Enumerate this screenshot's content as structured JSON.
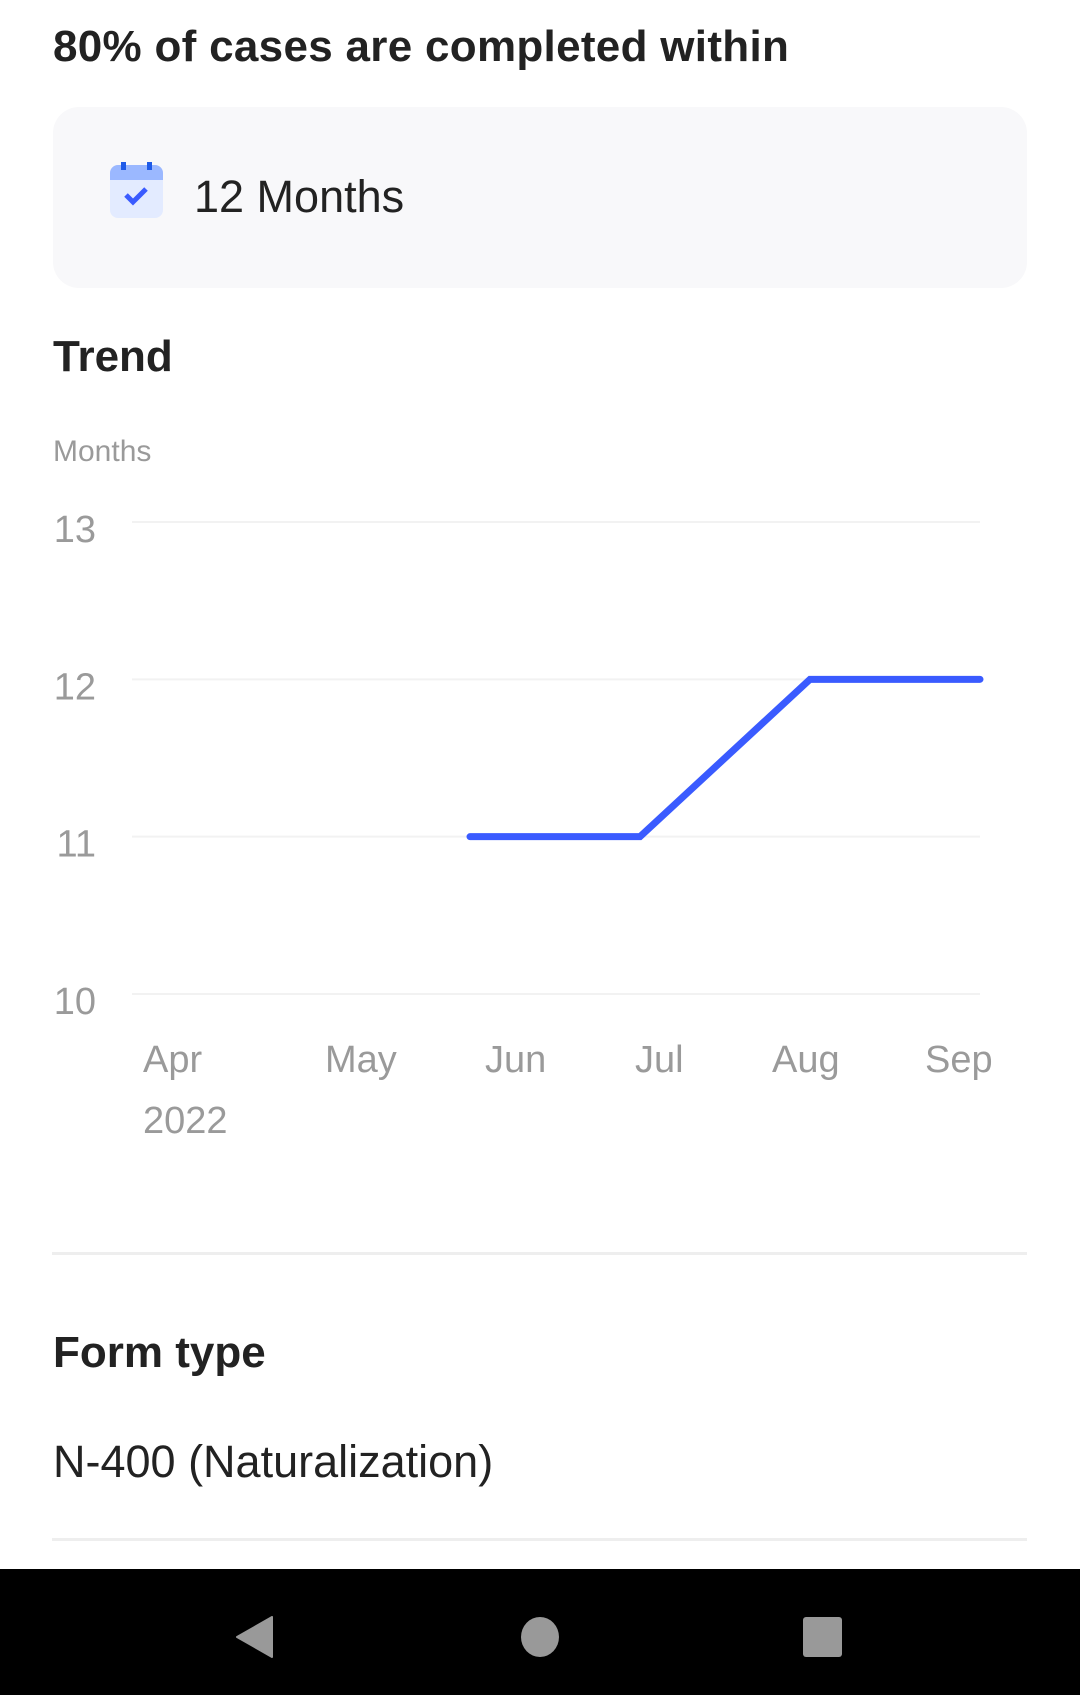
{
  "header": {
    "title": "80% of cases are completed within"
  },
  "summary_card": {
    "icon": "calendar-check-icon",
    "value": "12 Months"
  },
  "trend": {
    "heading": "Trend",
    "y_unit_label": "Months"
  },
  "chart_data": {
    "type": "line",
    "title": "Trend",
    "ylabel": "Months",
    "xlabel": "",
    "categories": [
      "Apr",
      "May",
      "Jun",
      "Jul",
      "Aug",
      "Sep"
    ],
    "x_tick_labels": [
      [
        "Apr",
        "2022"
      ],
      [
        "May"
      ],
      [
        "Jun"
      ],
      [
        "Jul"
      ],
      [
        "Aug"
      ],
      [
        "Sep"
      ]
    ],
    "y_ticks": [
      13,
      12,
      11,
      10
    ],
    "ylim": [
      10,
      13
    ],
    "grid": true,
    "series": [
      {
        "name": "Months",
        "color": "#3a5bff",
        "values": [
          null,
          null,
          11,
          11,
          12,
          12
        ]
      }
    ]
  },
  "form_type": {
    "heading": "Form type",
    "value": "N-400 (Naturalization)"
  },
  "navbar": {
    "back": "back-icon",
    "home": "home-icon",
    "recents": "recents-icon"
  },
  "colors": {
    "accent": "#3a5bff",
    "card_bg": "#f8f8fa",
    "muted_text": "#9a9a9a",
    "divider": "#eeeeee"
  }
}
